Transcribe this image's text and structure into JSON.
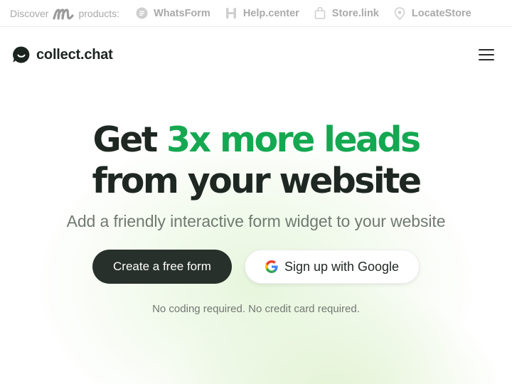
{
  "topbar": {
    "discover_label": "Discover",
    "products_label": "products:",
    "items": [
      {
        "label": "WhatsForm",
        "icon": "whatsform-icon"
      },
      {
        "label": "Help.center",
        "icon": "helpcenter-icon"
      },
      {
        "label": "Store.link",
        "icon": "shopping-bag-icon"
      },
      {
        "label": "LocateStore",
        "icon": "location-pin-icon"
      }
    ]
  },
  "nav": {
    "brand_name": "collect.chat",
    "menu_icon": "hamburger-menu-icon"
  },
  "hero": {
    "headline_prefix": "Get ",
    "headline_accent": "3x more leads",
    "headline_line2": "from your website",
    "subheadline": "Add a friendly interactive form widget to your website",
    "primary_cta": "Create a free form",
    "google_cta": "Sign up with Google",
    "note": "No coding required. No credit card required."
  },
  "colors": {
    "accent_green": "#14a851",
    "dark_button": "#27302a",
    "text_dark": "#1f2722",
    "muted_text": "#707a70"
  }
}
